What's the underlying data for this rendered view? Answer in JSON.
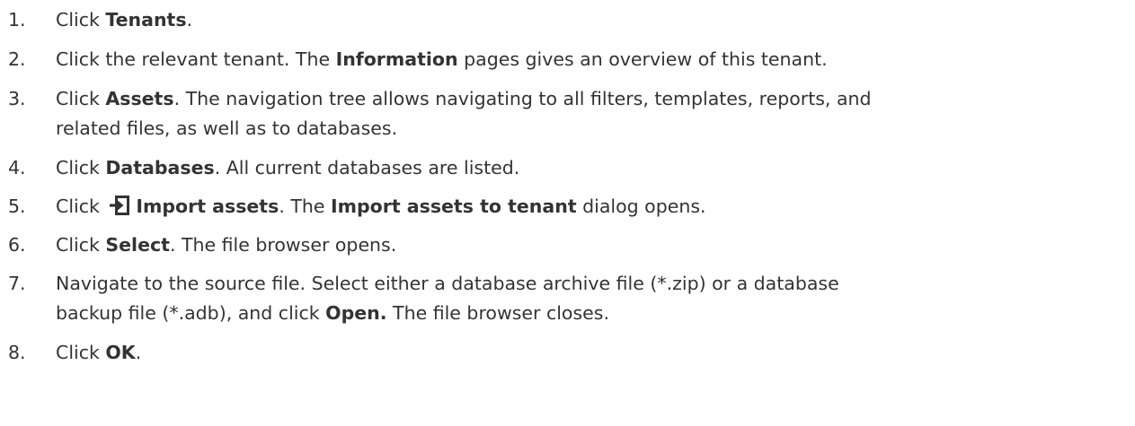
{
  "steps": [
    {
      "number": "1.",
      "p1": "Click ",
      "b1": "Tenants",
      "p2": "."
    },
    {
      "number": "2.",
      "p1": "Click the relevant tenant. The ",
      "b1": "Information",
      "p2": " pages gives an overview of this tenant."
    },
    {
      "number": "3.",
      "p1": "Click ",
      "b1": "Assets",
      "p2": ". The navigation tree allows navigating to all filters, templates, reports, and",
      "line2": "related files, as well as to databases."
    },
    {
      "number": "4.",
      "p1": "Click ",
      "b1": "Databases",
      "p2": ". All current databases are listed."
    },
    {
      "number": "5.",
      "p1": "Click ",
      "icon": "import-icon",
      "b1": "Import assets",
      "p2": ". The ",
      "b2": "Import assets to tenant",
      "p3": " dialog opens."
    },
    {
      "number": "6.",
      "p1": "Click ",
      "b1": "Select",
      "p2": ". The file browser opens."
    },
    {
      "number": "7.",
      "p1": "Navigate to the source file. Select either a database archive file (*.zip) or a database",
      "line2a": "backup file (*.adb), and click ",
      "line2b": "Open.",
      "line2c": " The file browser closes."
    },
    {
      "number": "8.",
      "p1": "Click ",
      "b1": "OK",
      "p2": "."
    }
  ]
}
